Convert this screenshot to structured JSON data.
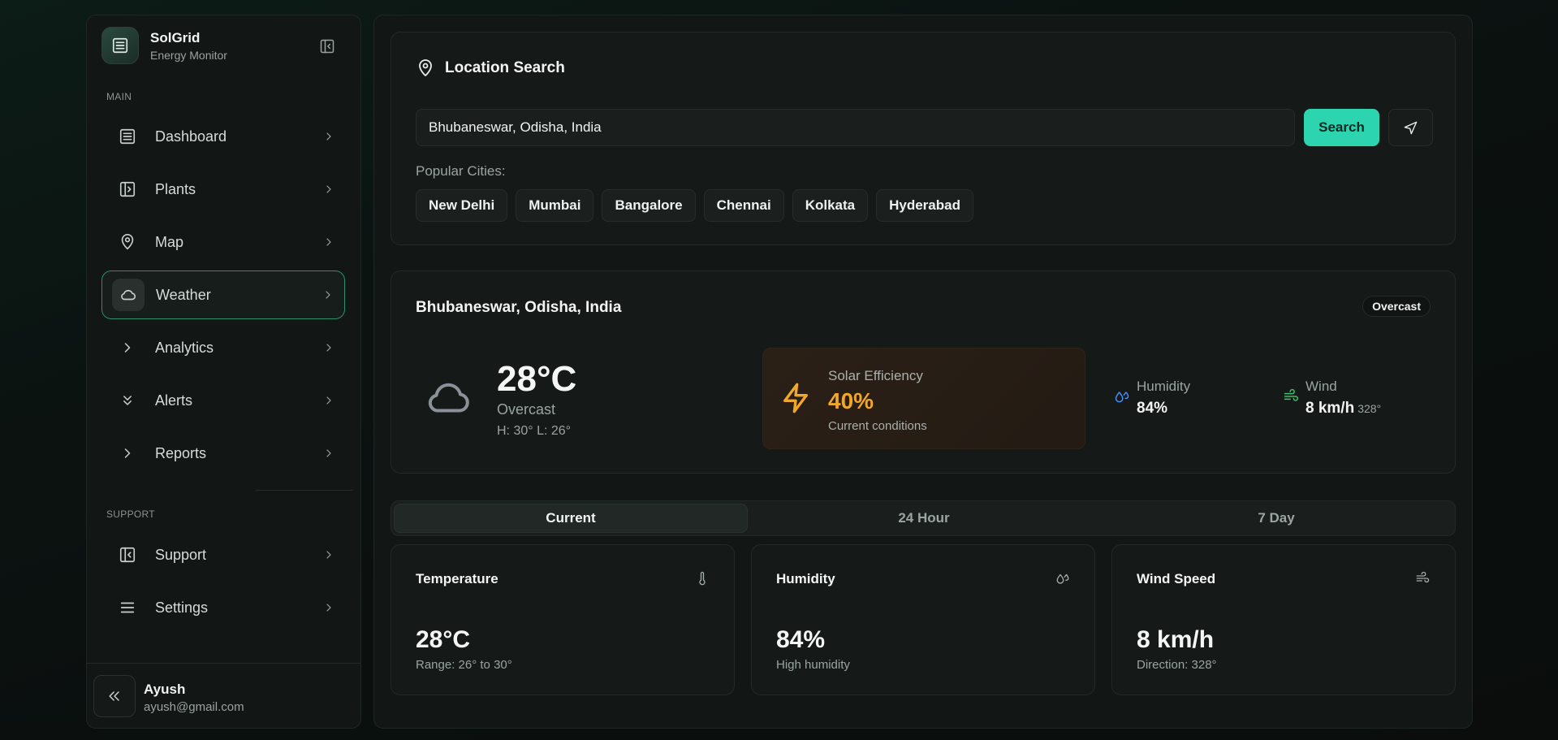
{
  "brand": {
    "name": "SolGrid",
    "subtitle": "Energy Monitor"
  },
  "sidebar": {
    "main_label": "MAIN",
    "support_label": "SUPPORT",
    "items": [
      {
        "label": "Dashboard",
        "icon": "list-icon"
      },
      {
        "label": "Plants",
        "icon": "panel-icon"
      },
      {
        "label": "Map",
        "icon": "map-pin-icon"
      },
      {
        "label": "Weather",
        "icon": "cloud-icon",
        "active": true
      },
      {
        "label": "Analytics",
        "icon": "chevron-right-icon"
      },
      {
        "label": "Alerts",
        "icon": "chevrons-down-icon"
      },
      {
        "label": "Reports",
        "icon": "chevron-right-icon"
      }
    ],
    "support_items": [
      {
        "label": "Support",
        "icon": "panel-left-icon"
      },
      {
        "label": "Settings",
        "icon": "menu-icon"
      }
    ]
  },
  "user": {
    "name": "Ayush",
    "email": "ayush@gmail.com"
  },
  "search": {
    "title": "Location Search",
    "value": "Bhubaneswar, Odisha, India",
    "button_label": "Search",
    "popular_label": "Popular Cities:",
    "cities": [
      "New Delhi",
      "Mumbai",
      "Bangalore",
      "Chennai",
      "Kolkata",
      "Hyderabad"
    ]
  },
  "current": {
    "location": "Bhubaneswar, Odisha, India",
    "badge": "Overcast",
    "temperature": "28°C",
    "condition": "Overcast",
    "hilo": "H: 30° L: 26°",
    "solar_label": "Solar Efficiency",
    "solar_value": "40%",
    "solar_sub": "Current conditions",
    "humidity_label": "Humidity",
    "humidity_value": "84%",
    "wind_label": "Wind",
    "wind_value": "8 km/h",
    "wind_dir": "328°"
  },
  "tabs": [
    "Current",
    "24 Hour",
    "7 Day"
  ],
  "metrics": [
    {
      "title": "Temperature",
      "value": "28°C",
      "sub": "Range: 26° to 30°",
      "icon": "thermometer-icon"
    },
    {
      "title": "Humidity",
      "value": "84%",
      "sub": "High humidity",
      "icon": "droplets-icon"
    },
    {
      "title": "Wind Speed",
      "value": "8 km/h",
      "sub": "Direction: 328°",
      "icon": "wind-icon"
    }
  ],
  "colors": {
    "accent": "#2dd4b0",
    "solar": "#f0a72a",
    "humidity_icon": "#4a8cf0",
    "wind_icon": "#3fbf6f"
  }
}
